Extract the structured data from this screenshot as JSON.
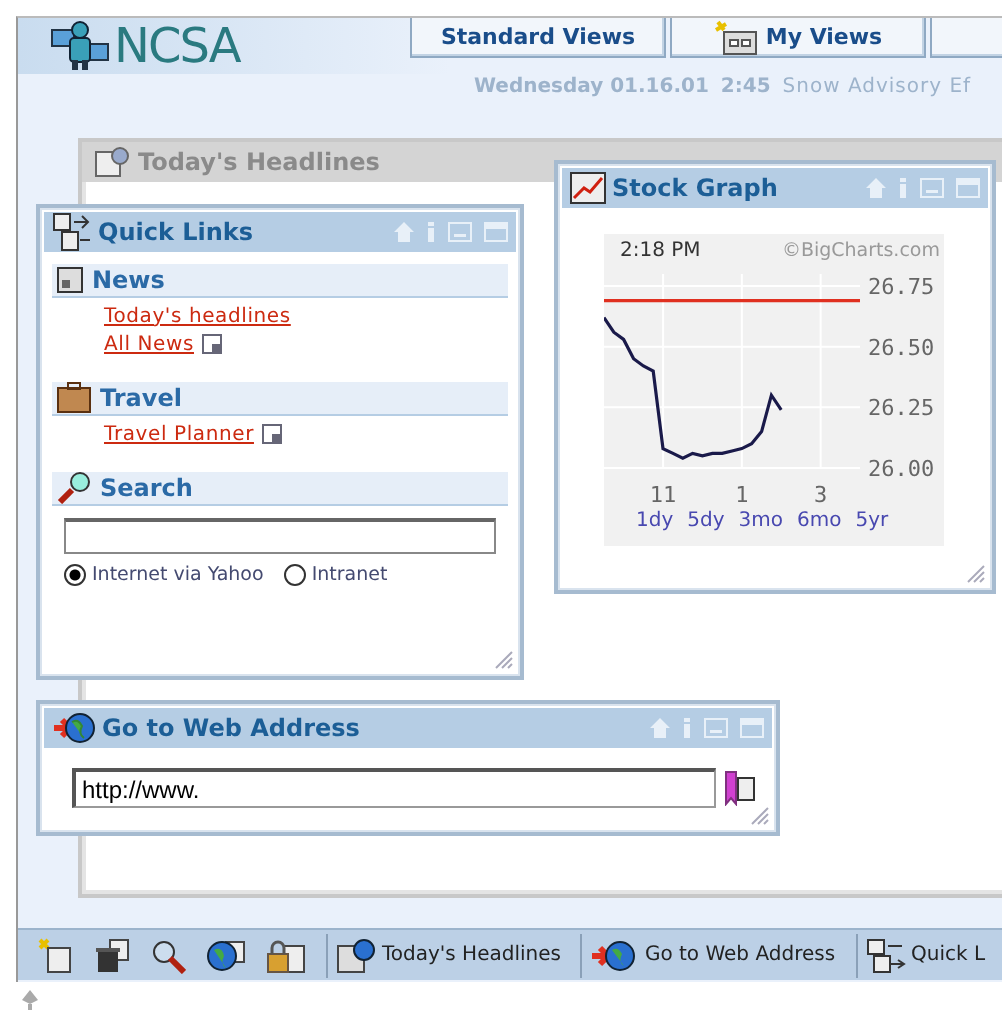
{
  "header": {
    "logo": "NCSA",
    "tabs": [
      {
        "label": "Standard Views"
      },
      {
        "label": "My Views"
      }
    ]
  },
  "status_line": {
    "date": "Wednesday 01.16.01",
    "time": "2:45",
    "ticker": "Snow Advisory Ef"
  },
  "background_window": {
    "title": "Today's Headlines"
  },
  "quick_links": {
    "title": "Quick Links",
    "sections": [
      {
        "kind": "links",
        "heading": "News",
        "links": [
          {
            "label": "Today's headlines",
            "external": false
          },
          {
            "label": "All News",
            "external": true
          }
        ]
      },
      {
        "kind": "links",
        "heading": "Travel",
        "links": [
          {
            "label": "Travel Planner",
            "external": true
          }
        ]
      },
      {
        "kind": "search",
        "heading": "Search",
        "options": [
          {
            "label": "Internet via Yahoo",
            "selected": true
          },
          {
            "label": "Intranet",
            "selected": false
          }
        ]
      }
    ]
  },
  "stock_graph": {
    "title": "Stock Graph",
    "time": "2:18 PM",
    "credit": "©BigCharts.com",
    "ranges": [
      "1dy",
      "5dy",
      "3mo",
      "6mo",
      "5yr"
    ],
    "chart_data": {
      "type": "line",
      "grid": true,
      "ylim": [
        26.0,
        26.75
      ],
      "categories": [
        null,
        null,
        null,
        null,
        null,
        null,
        "11",
        null,
        null,
        null,
        null,
        null,
        null,
        null,
        "1",
        null,
        null,
        null,
        null,
        null,
        null,
        null,
        "3",
        null,
        null,
        null,
        null
      ],
      "yticks": [
        {
          "value": 26.75,
          "label": "26.75"
        },
        {
          "value": 26.5,
          "label": "26.50"
        },
        {
          "value": 26.25,
          "label": "26.25"
        },
        {
          "value": 26.0,
          "label": "26.00"
        }
      ],
      "series": [
        {
          "color": "#e03020",
          "values": [
            26.69,
            26.69,
            26.69,
            26.69,
            26.69,
            26.69,
            26.69,
            26.69,
            26.69,
            26.69,
            26.69,
            26.69,
            26.69,
            26.69,
            26.69,
            26.69,
            26.69,
            26.69,
            26.69,
            26.69,
            26.69,
            26.69,
            26.69,
            26.69,
            26.69,
            26.69,
            26.69
          ]
        },
        {
          "color": "#1a1a4a",
          "values": [
            26.62,
            26.56,
            26.53,
            26.45,
            26.42,
            26.4,
            26.08,
            26.06,
            26.04,
            26.06,
            26.05,
            26.06,
            26.06,
            26.07,
            26.08,
            26.1,
            26.15,
            26.3,
            26.24,
            null,
            null,
            null,
            null,
            null,
            null,
            null,
            null
          ]
        }
      ]
    }
  },
  "web_address": {
    "title": "Go to Web Address",
    "value": "http://www."
  },
  "taskbar": {
    "windows": [
      "Today's Headlines",
      "Go to Web Address",
      "Quick L"
    ]
  }
}
